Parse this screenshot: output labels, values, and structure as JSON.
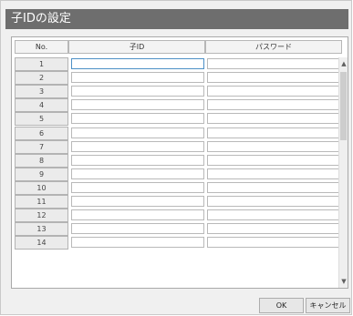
{
  "dialog": {
    "title": "子IDの設定"
  },
  "table": {
    "headers": {
      "no": "No.",
      "child_id": "子ID",
      "password": "パスワード"
    },
    "rows": [
      {
        "no": "1",
        "child_id": "",
        "password": ""
      },
      {
        "no": "2",
        "child_id": "",
        "password": ""
      },
      {
        "no": "3",
        "child_id": "",
        "password": ""
      },
      {
        "no": "4",
        "child_id": "",
        "password": ""
      },
      {
        "no": "5",
        "child_id": "",
        "password": ""
      },
      {
        "no": "6",
        "child_id": "",
        "password": ""
      },
      {
        "no": "7",
        "child_id": "",
        "password": ""
      },
      {
        "no": "8",
        "child_id": "",
        "password": ""
      },
      {
        "no": "9",
        "child_id": "",
        "password": ""
      },
      {
        "no": "10",
        "child_id": "",
        "password": ""
      },
      {
        "no": "11",
        "child_id": "",
        "password": ""
      },
      {
        "no": "12",
        "child_id": "",
        "password": ""
      },
      {
        "no": "13",
        "child_id": "",
        "password": ""
      },
      {
        "no": "14",
        "child_id": "",
        "password": ""
      }
    ]
  },
  "scrollbar": {
    "up_icon": "chevron-up-icon",
    "down_icon": "chevron-down-icon"
  },
  "buttons": {
    "ok": "OK",
    "cancel": "キャンセル"
  }
}
